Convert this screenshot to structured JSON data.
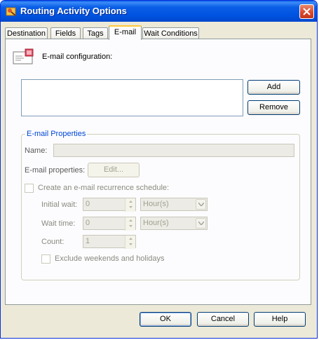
{
  "window": {
    "title": "Routing Activity Options"
  },
  "tabs": [
    {
      "label": "Destination",
      "active": false
    },
    {
      "label": "Fields",
      "active": false
    },
    {
      "label": "Tags",
      "active": false
    },
    {
      "label": "E-mail",
      "active": true
    },
    {
      "label": "Wait Conditions",
      "active": false
    }
  ],
  "email": {
    "configuration_label": "E-mail configuration:",
    "list_items": [],
    "add_label": "Add",
    "remove_label": "Remove"
  },
  "properties": {
    "group_title": "E-mail Properties",
    "name_label": "Name:",
    "name_value": "",
    "email_properties_label": "E-mail properties:",
    "edit_label": "Edit...",
    "recurrence": {
      "label": "Create an e-mail recurrence schedule:",
      "checked": false,
      "initial_wait_label": "Initial wait:",
      "initial_wait_value": "0",
      "initial_wait_unit": "Hour(s)",
      "wait_time_label": "Wait time:",
      "wait_time_value": "0",
      "wait_time_unit": "Hour(s)",
      "count_label": "Count:",
      "count_value": "1",
      "exclude_label": "Exclude weekends and holidays",
      "exclude_checked": false
    }
  },
  "footer": {
    "ok_label": "OK",
    "cancel_label": "Cancel",
    "help_label": "Help"
  },
  "icons": {
    "app": "routing-activity-icon",
    "email": "email-envelope-icon",
    "close": "close-icon"
  },
  "colors": {
    "title_bar": "#0053e0",
    "group_title": "#0046d5",
    "active_tab_highlight": "#ffc83c",
    "close_button": "#d8462b"
  }
}
